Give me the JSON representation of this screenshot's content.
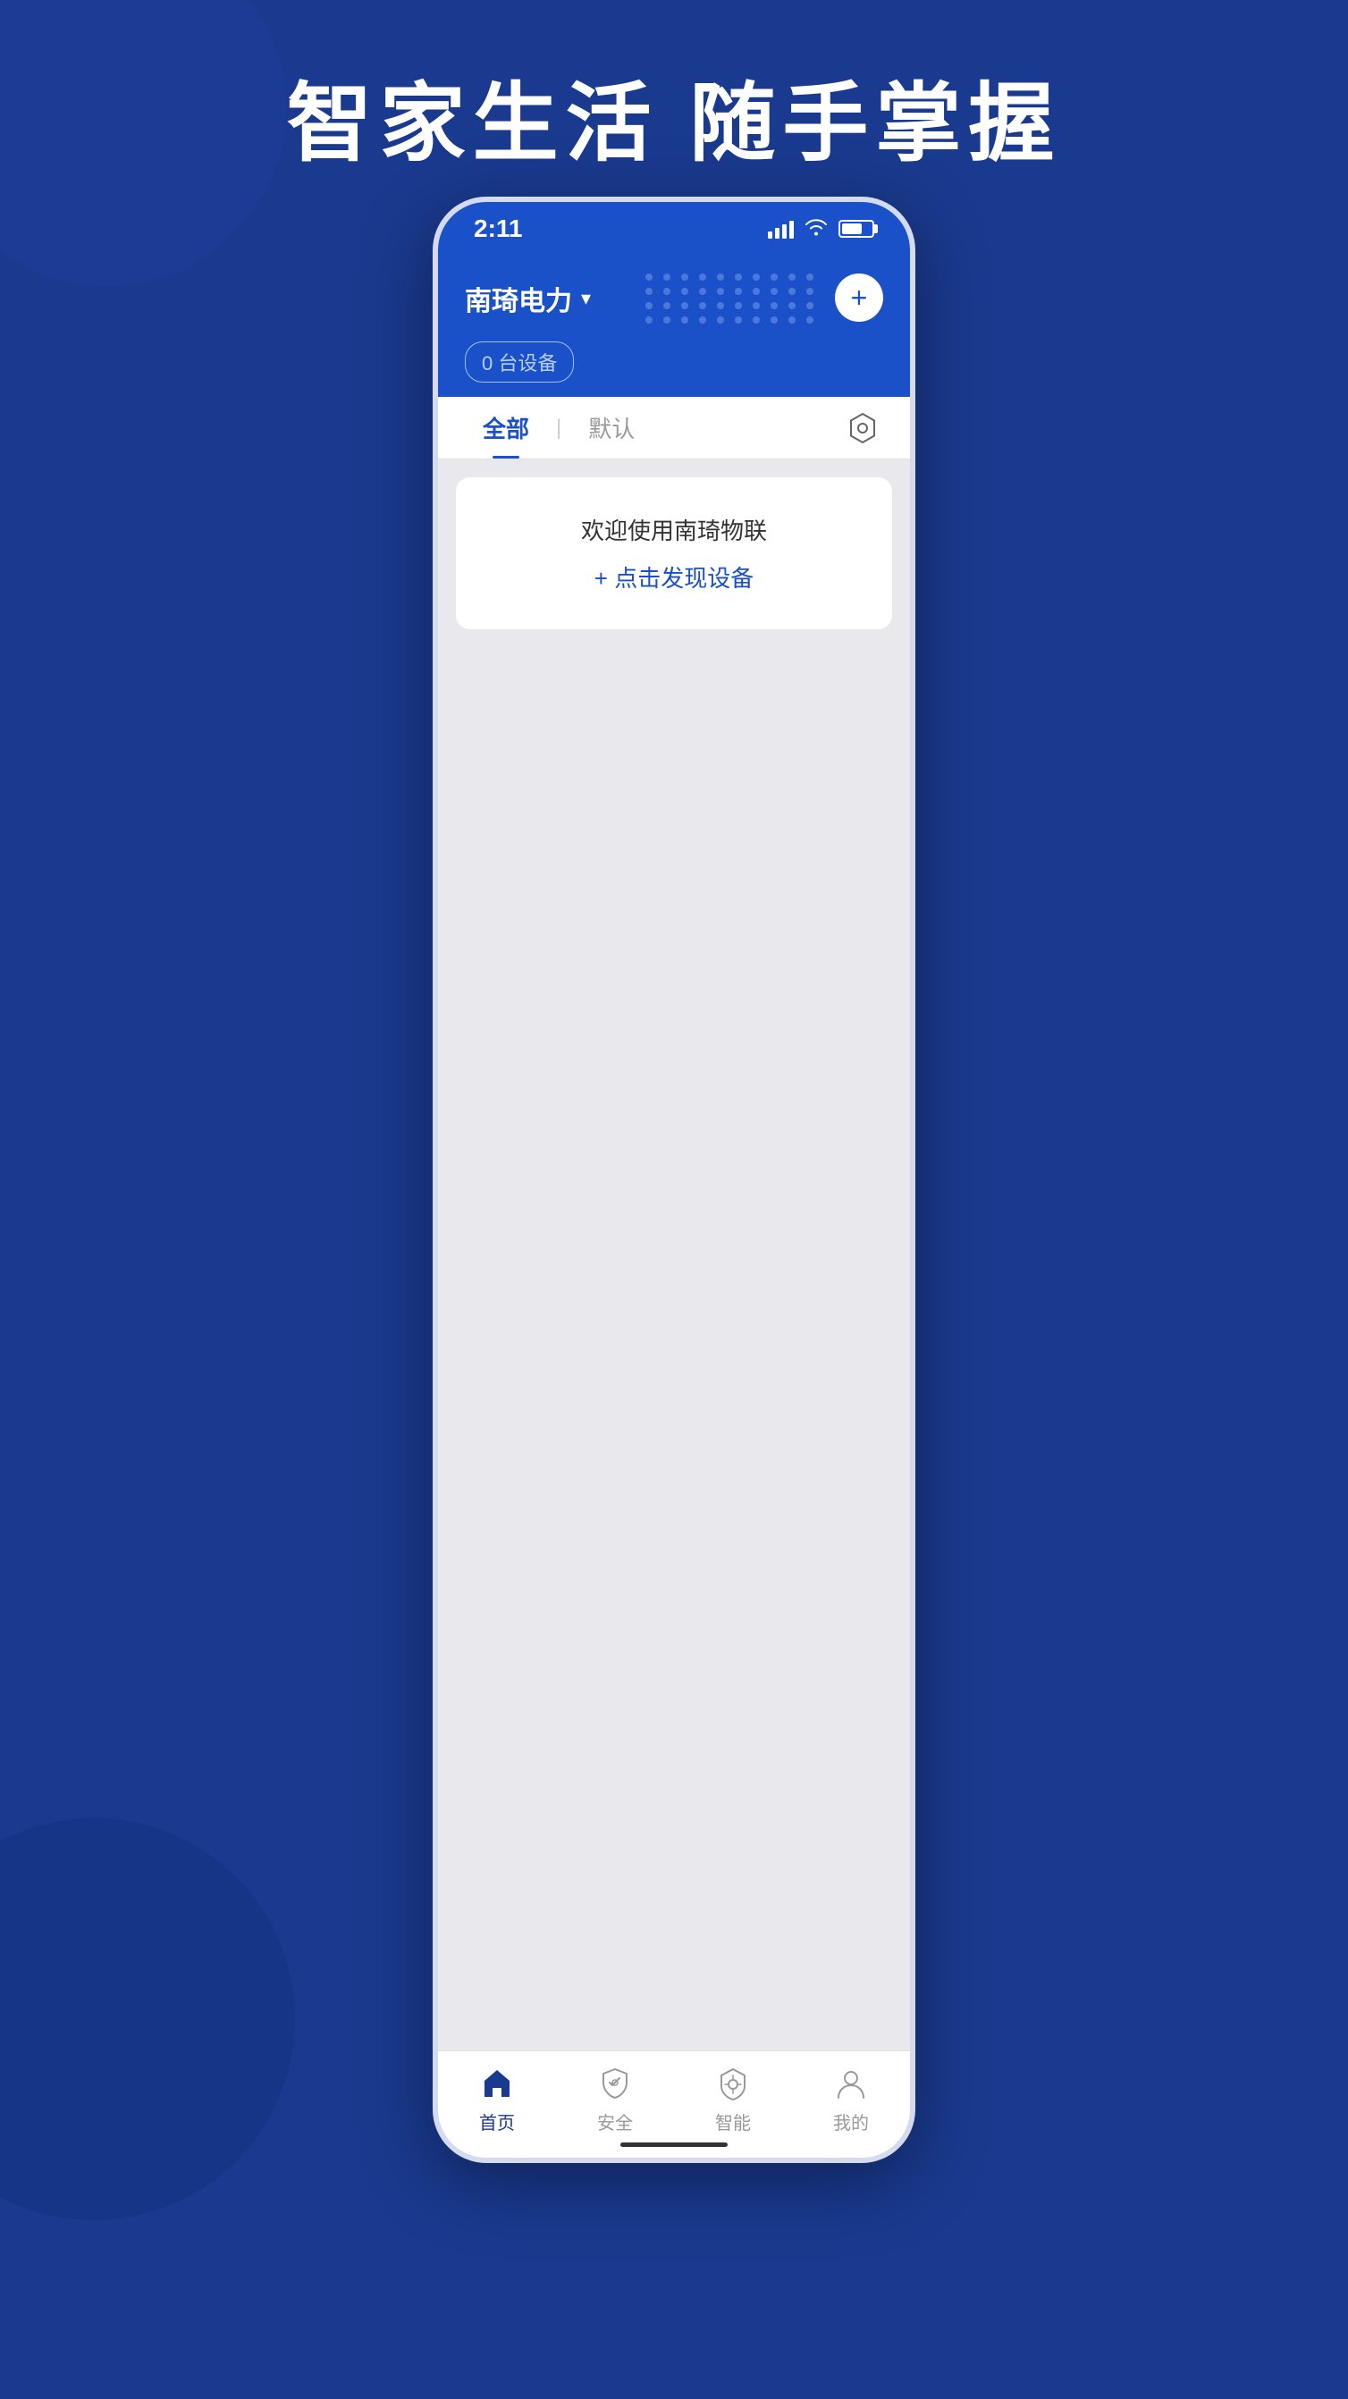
{
  "background": {
    "color": "#1a3a8f"
  },
  "hero": {
    "text": "智家生活   随手掌握"
  },
  "phone": {
    "statusBar": {
      "time": "2:11",
      "icons": [
        "signal",
        "wifi",
        "battery"
      ]
    },
    "header": {
      "locationName": "南琦电力",
      "deviceCount": "0 台设备",
      "addButtonLabel": "+"
    },
    "tabs": [
      {
        "label": "全部",
        "active": true
      },
      {
        "label": "默认",
        "active": false
      }
    ],
    "settingsIconLabel": "settings-icon",
    "welcomeCard": {
      "welcomeText": "欢迎使用南琦物联",
      "discoverText": "+ 点击发现设备"
    },
    "bottomNav": [
      {
        "label": "首页",
        "active": true,
        "icon": "home"
      },
      {
        "label": "安全",
        "active": false,
        "icon": "shield"
      },
      {
        "label": "智能",
        "active": false,
        "icon": "smart"
      },
      {
        "label": "我的",
        "active": false,
        "icon": "profile"
      }
    ]
  }
}
